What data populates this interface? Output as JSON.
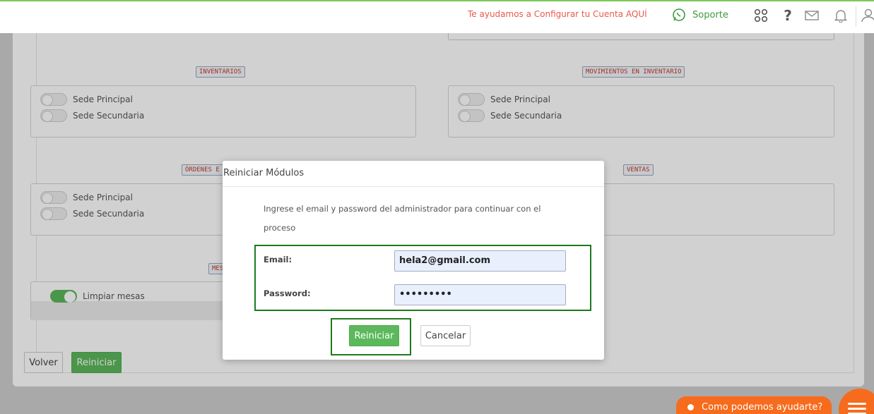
{
  "topbar": {
    "help_link": "Te ayudamos a Configurar tu Cuenta AQUÍ",
    "support_label": "Soporte",
    "icons": [
      "whatsapp-icon",
      "apps-icon",
      "help-icon",
      "mail-icon",
      "bell-icon",
      "user-icon"
    ],
    "help_glyph": "?"
  },
  "sections": {
    "inventarios": {
      "label": "INVENTARIOS",
      "items": [
        "Sede Principal",
        "Sede Secundaria"
      ]
    },
    "movimientos": {
      "label": "MOVIMIENTOS EN INVENTARIO",
      "items": [
        "Sede Principal",
        "Sede Secundaria"
      ]
    },
    "ordenes": {
      "label": "ÓRDENES E",
      "items": [
        "Sede Principal",
        "Sede Secundaria"
      ]
    },
    "ventas": {
      "label": "VENTAS"
    },
    "mesas": {
      "label": "MES",
      "items": [
        "Limpiar mesas"
      ],
      "enabled": [
        true
      ]
    }
  },
  "page_buttons": {
    "back": "Volver",
    "reset": "Reiniciar"
  },
  "modal": {
    "title": "Reiniciar Módulos",
    "message": "Ingrese el email y password del administrador para continuar con el proceso",
    "email_label": "Email:",
    "email_value": "hela2@gmail.com",
    "password_label": "Password:",
    "password_value": "•••••••••",
    "confirm": "Reiniciar",
    "cancel": "Cancelar"
  },
  "chat": {
    "label": "Como podemos ayudarte?"
  },
  "colors": {
    "brand_green": "#5cb85c",
    "highlight": "#1d7a1d",
    "chat_orange": "#f76b1c",
    "link_red": "#e8594b"
  }
}
